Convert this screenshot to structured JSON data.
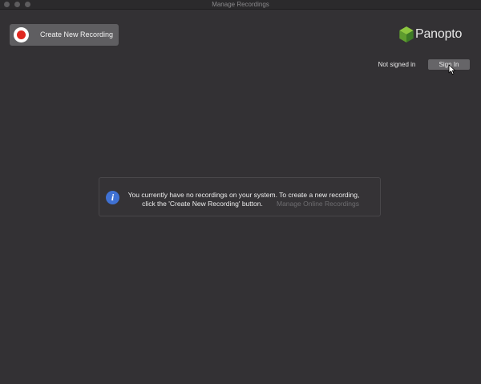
{
  "window": {
    "title": "Manage Recordings"
  },
  "toolbar": {
    "create_label": "Create New Recording",
    "record_icon_color": "#e0271f"
  },
  "brand": {
    "logo_text": "Panopto",
    "logo_colors": [
      "#8cc63f",
      "#5e9c2e",
      "#3d7a26"
    ]
  },
  "account": {
    "status": "Not signed in",
    "sign_in_label": "Sign In"
  },
  "empty_state": {
    "line1": "You currently have no recordings on your system. To create a new recording,",
    "line2": "click the 'Create New Recording' button.",
    "manage_online_label": "Manage Online Recordings",
    "icon": "info-icon",
    "icon_color": "#3f71d3"
  }
}
